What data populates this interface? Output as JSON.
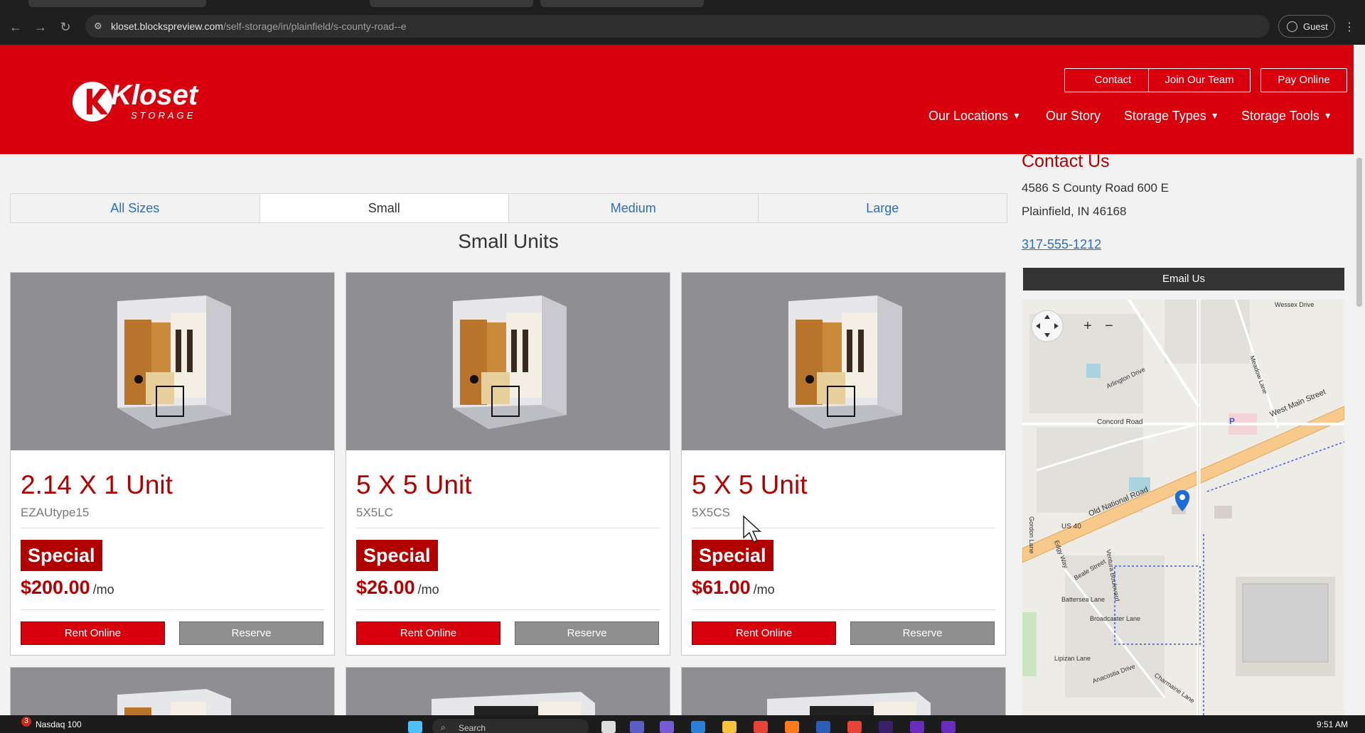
{
  "browser": {
    "url_host": "kloset.blockspreview.com",
    "url_path": "/self-storage/in/plainfield/s-county-road--e",
    "profile_label": "Guest"
  },
  "header": {
    "logo_text": "Kloset",
    "logo_sub": "STORAGE",
    "top_buttons": [
      "Contact",
      "Join Our Team",
      "Pay Online"
    ],
    "nav": [
      "Our Locations",
      "Our Story",
      "Storage Types",
      "Storage Tools"
    ]
  },
  "size_filter": {
    "tabs": [
      "All Sizes",
      "Small",
      "Medium",
      "Large"
    ],
    "active": "Small"
  },
  "section_title": "Small Units",
  "units": [
    {
      "name": "2.14 X 1 Unit",
      "code": "EZAUtype15",
      "badge": "Special",
      "price": "$200.00",
      "per": "/mo",
      "rent": "Rent Online",
      "reserve": "Reserve"
    },
    {
      "name": "5 X 5 Unit",
      "code": "5X5LC",
      "badge": "Special",
      "price": "$26.00",
      "per": "/mo",
      "rent": "Rent Online",
      "reserve": "Reserve"
    },
    {
      "name": "5 X 5 Unit",
      "code": "5X5CS",
      "badge": "Special",
      "price": "$61.00",
      "per": "/mo",
      "rent": "Rent Online",
      "reserve": "Reserve"
    }
  ],
  "contact": {
    "title": "Contact Us",
    "address_line1": "4586 S County Road 600 E",
    "address_line2": "Plainfield, IN 46168",
    "phone": "317-555-1212",
    "email_button": "Email Us"
  },
  "map": {
    "labels": {
      "west_main": "West Main Street",
      "old_national": "Old National Road",
      "concord": "Concord Road",
      "us40": "US 40",
      "arlington": "Arlington Drive",
      "battersea": "Battersea Lane",
      "broadcaster": "Broadcaster Lane",
      "lipizan": "Lipizan Lane",
      "anacostia": "Anacostia Drive",
      "charmaine": "Charmaine Lane",
      "meadow": "Meadow Lane",
      "wessex": "Wessex Drive",
      "edgy": "Edgy Way",
      "beale": "Beale Street",
      "ventura": "Ventura Boulevard",
      "gordon": "Gordon Lane",
      "parking": "P"
    },
    "zoom_in": "+",
    "zoom_out": "−"
  },
  "taskbar": {
    "stock_label": "Nasdaq 100",
    "stock_badge": "3",
    "search_label": "Search",
    "time": "9:51 AM"
  },
  "colors": {
    "brand_red": "#d9000d",
    "price_red": "#b20000",
    "link_blue": "#2a6ebb"
  }
}
